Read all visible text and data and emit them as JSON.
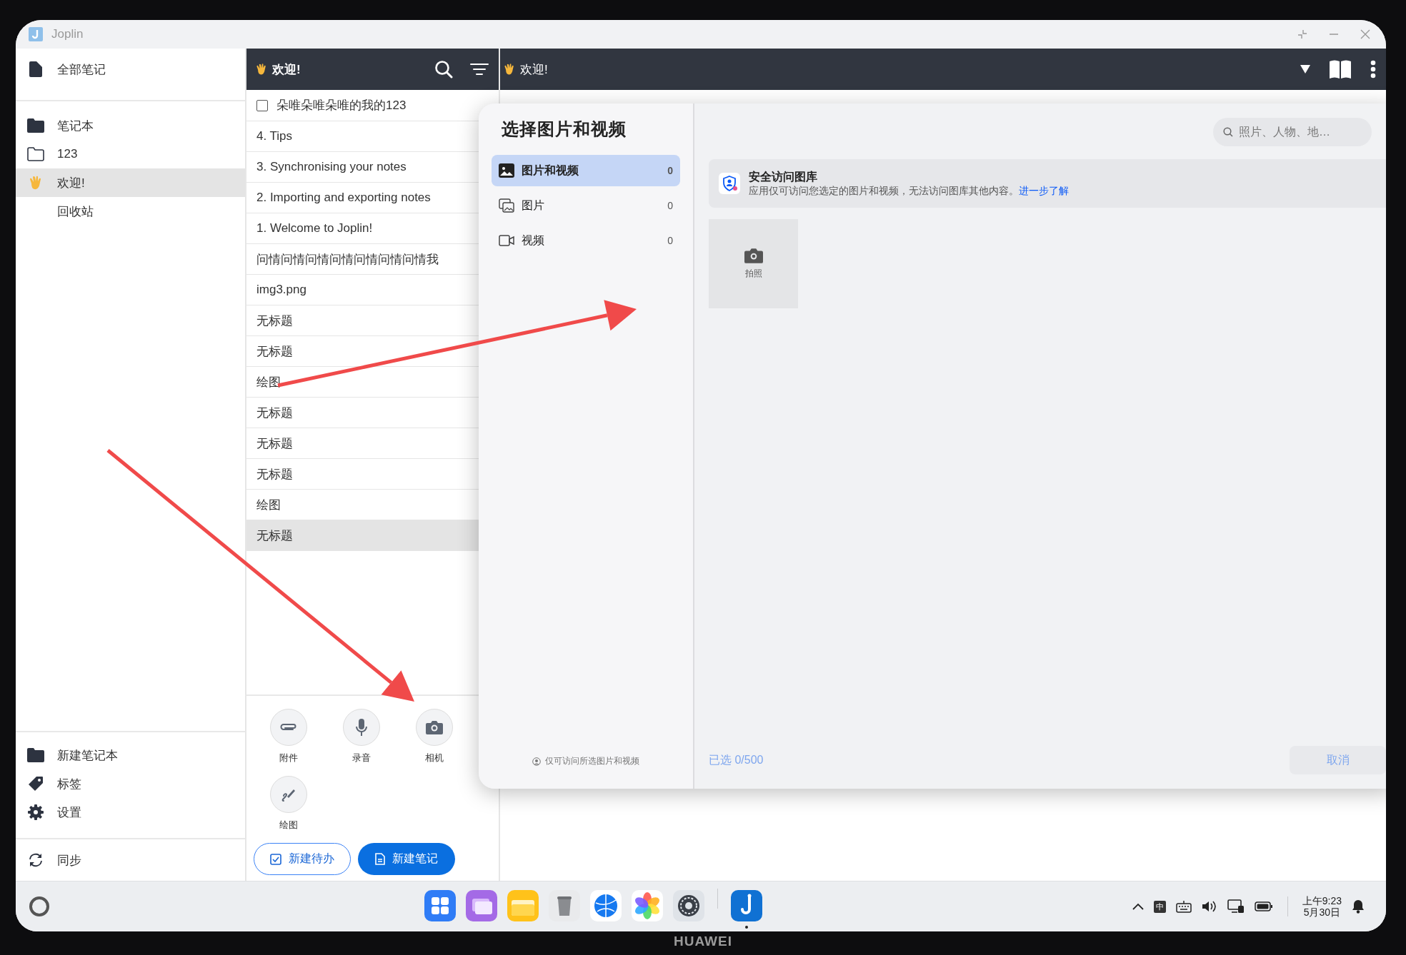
{
  "window": {
    "title": "Joplin"
  },
  "sidebar": {
    "all_notes": "全部笔记",
    "notebooks_heading": "笔记本",
    "notebooks": [
      {
        "label": "123",
        "kind": "folder",
        "selected": false
      },
      {
        "label": "欢迎!",
        "kind": "emoji",
        "selected": true
      },
      {
        "label": "回收站",
        "kind": "plain",
        "selected": false
      }
    ],
    "footer": [
      {
        "label": "新建笔记本",
        "kind": "notebook"
      },
      {
        "label": "标签",
        "kind": "tag"
      },
      {
        "label": "设置",
        "kind": "settings"
      }
    ],
    "sync": "同步"
  },
  "note_list": {
    "title": "欢迎!",
    "notes": [
      {
        "title": "朵唯朵唯朵唯的我的123",
        "kind": "todo",
        "checked": false,
        "selected": false
      },
      {
        "title": "4. Tips",
        "kind": "note",
        "selected": false
      },
      {
        "title": "3. Synchronising your notes",
        "kind": "note",
        "selected": false
      },
      {
        "title": "2. Importing and exporting notes",
        "kind": "note",
        "selected": false
      },
      {
        "title": "1. Welcome to Joplin!",
        "kind": "note",
        "selected": false
      },
      {
        "title": "问情问情问情问情问情问情问情我",
        "kind": "note",
        "selected": false
      },
      {
        "title": "img3.png",
        "kind": "note",
        "selected": false
      },
      {
        "title": "无标题",
        "kind": "note",
        "selected": false
      },
      {
        "title": "无标题",
        "kind": "note",
        "selected": false
      },
      {
        "title": "绘图",
        "kind": "note",
        "selected": false
      },
      {
        "title": "无标题",
        "kind": "note",
        "selected": false
      },
      {
        "title": "无标题",
        "kind": "note",
        "selected": false
      },
      {
        "title": "无标题",
        "kind": "note",
        "selected": false
      },
      {
        "title": "绘图",
        "kind": "note",
        "selected": false
      },
      {
        "title": "无标题",
        "kind": "note",
        "selected": true
      }
    ],
    "actions": [
      {
        "label": "附件",
        "kind": "attach"
      },
      {
        "label": "录音",
        "kind": "record"
      },
      {
        "label": "相机",
        "kind": "camera"
      },
      {
        "label": "绘图",
        "kind": "draw"
      }
    ],
    "new_todo": "新建待办",
    "new_note": "新建笔记"
  },
  "editor": {
    "title": "欢迎!"
  },
  "picker": {
    "title": "选择图片和视频",
    "albums": [
      {
        "label": "图片和视频",
        "count": "0",
        "kind": "all",
        "selected": true
      },
      {
        "label": "图片",
        "count": "0",
        "kind": "photos",
        "selected": false
      },
      {
        "label": "视频",
        "count": "0",
        "kind": "videos",
        "selected": false
      }
    ],
    "privacy_note": "仅可访问所选图片和视频",
    "search_placeholder": "照片、人物、地…",
    "notice": {
      "title": "安全访问图库",
      "text": "应用仅可访问您选定的图片和视频，无法访问图库其他内容。",
      "link": "进一步了解"
    },
    "capture_label": "拍照",
    "selected_count": "已选 0/500",
    "cancel": "取消"
  },
  "taskbar": {
    "apps": [
      {
        "kind": "launcher"
      },
      {
        "kind": "windows"
      },
      {
        "kind": "files"
      },
      {
        "kind": "trash"
      },
      {
        "kind": "browser"
      },
      {
        "kind": "gallery"
      },
      {
        "kind": "settings"
      },
      {
        "kind": "joplin",
        "running": true
      }
    ],
    "ime": "中",
    "time": "上午9:23",
    "date": "5月30日"
  },
  "annotations": [
    {
      "kind": "arrow"
    },
    {
      "kind": "arrow"
    }
  ],
  "device": {
    "brand": "HUAWEI"
  }
}
